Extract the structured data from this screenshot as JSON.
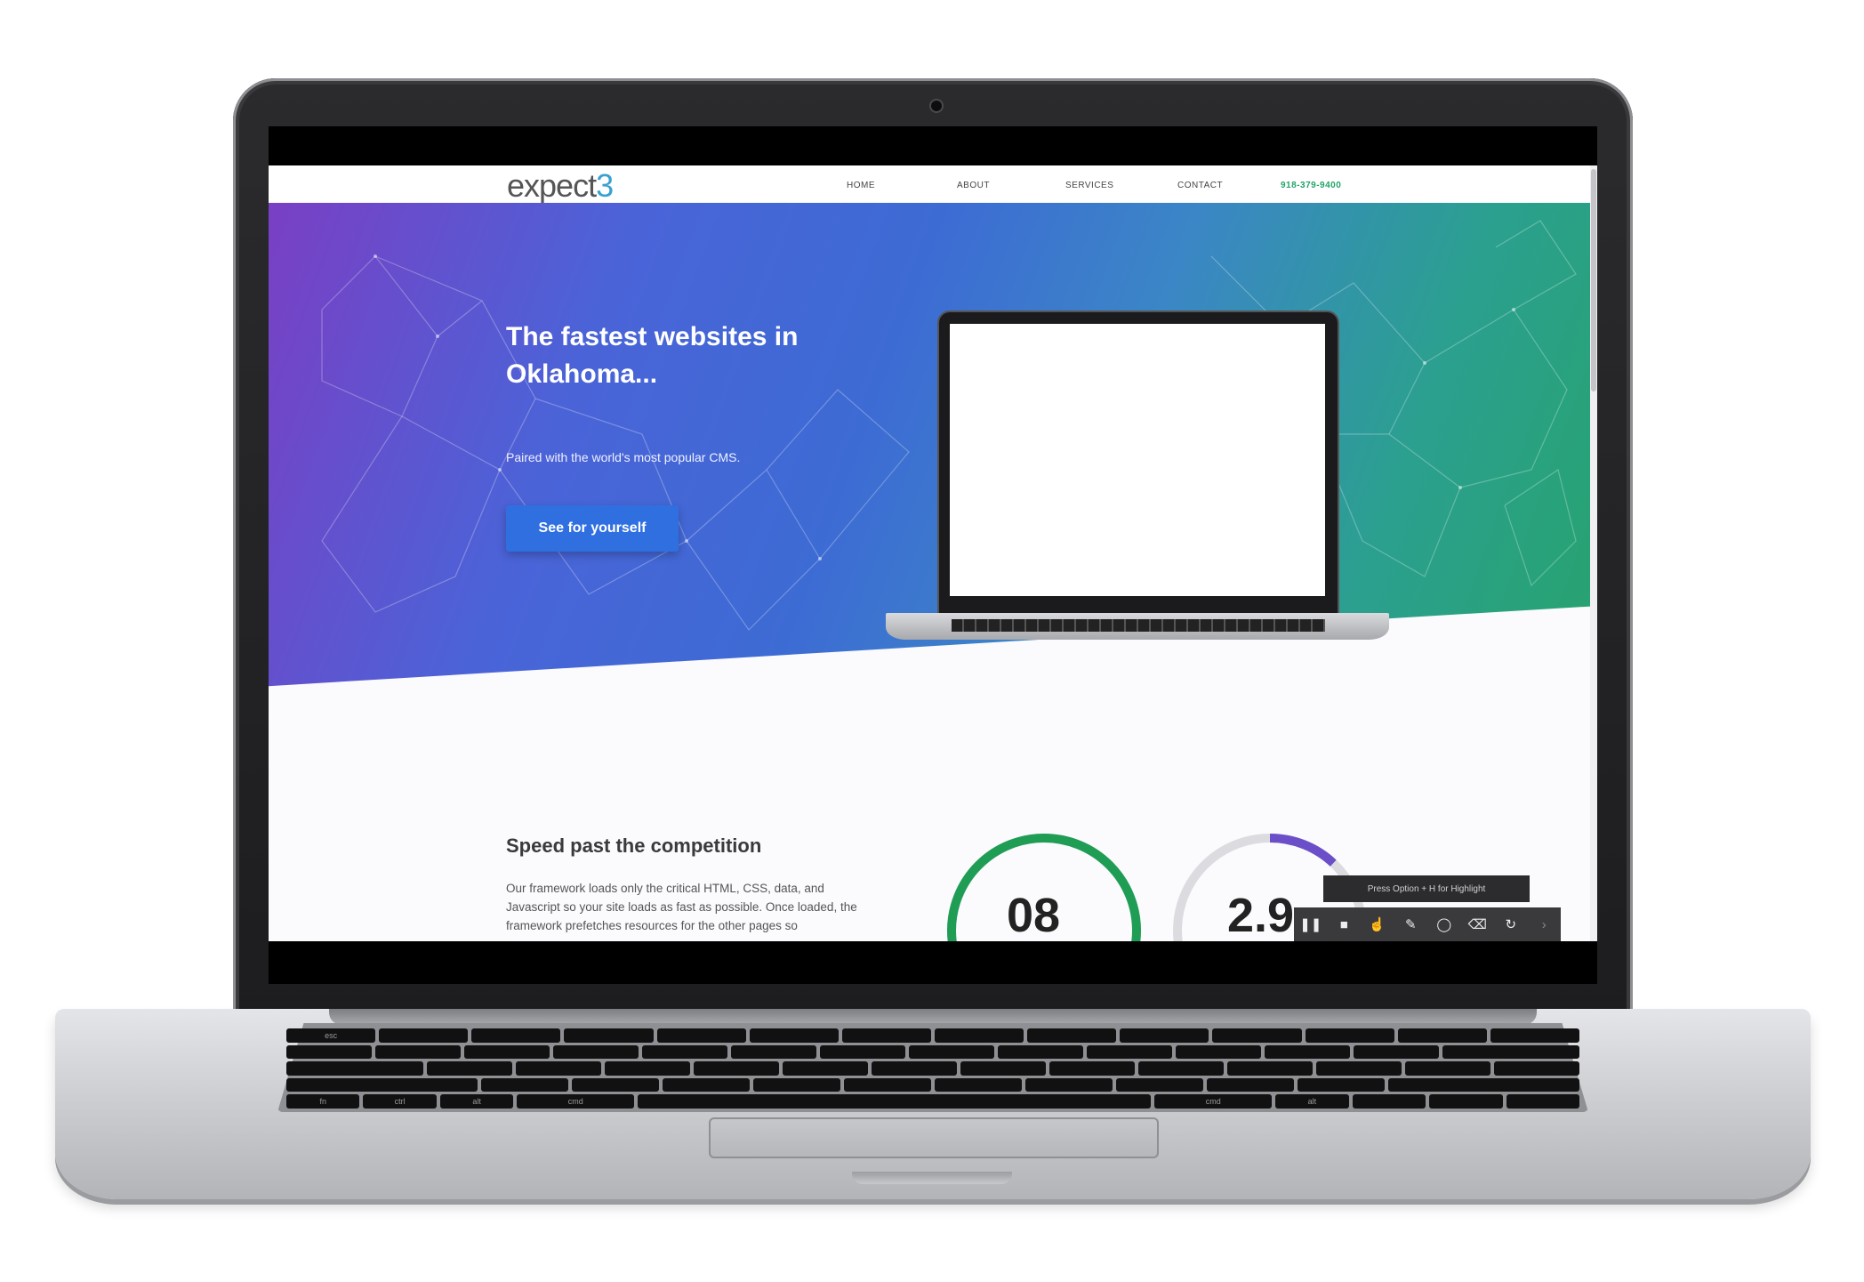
{
  "site": {
    "logo_text": "expect",
    "logo_accent": "3",
    "nav": [
      {
        "label": "HOME"
      },
      {
        "label": "ABOUT"
      },
      {
        "label": "SERVICES"
      },
      {
        "label": "CONTACT"
      }
    ],
    "phone": "918-379-9400"
  },
  "hero": {
    "title": "The fastest websites in Oklahoma...",
    "subtitle": "Paired with the world's most popular CMS.",
    "cta_label": "See for yourself"
  },
  "speed_section": {
    "title": "Speed past the competition",
    "body": "Our framework loads only the critical HTML, CSS, data, and Javascript so your site loads as fast as possible. Once loaded, the framework prefetches resources for the other pages so"
  },
  "gauges": [
    {
      "value_text": "08",
      "color": "#1f9d55",
      "fraction": 1.0
    },
    {
      "value_text": "2.9",
      "color": "#6b4fc8",
      "fraction": 0.12
    }
  ],
  "recorder": {
    "hint": "Press Option + H for Highlight",
    "tools": [
      "pause-icon",
      "stop-icon",
      "pointer-icon",
      "pen-icon",
      "circle-icon",
      "eraser-icon",
      "refresh-icon",
      "chevron-right-icon"
    ]
  },
  "keyboard": {
    "row1": [
      "esc",
      "",
      "",
      "",
      "",
      "",
      "",
      "",
      "",
      "",
      "",
      "",
      "",
      ""
    ],
    "bottom_row": [
      "fn",
      "ctrl",
      "alt",
      "cmd",
      "",
      "cmd",
      "alt",
      "",
      "",
      ""
    ]
  },
  "colors": {
    "hero_start": "#7a3fc4",
    "hero_mid": "#3d6bd4",
    "hero_end": "#27a36d",
    "cta": "#2f6fe0",
    "phone": "#22a26a"
  }
}
